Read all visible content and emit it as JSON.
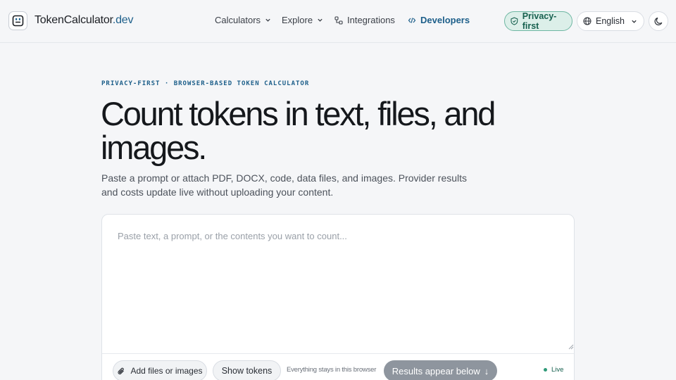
{
  "header": {
    "brand_main": "TokenCalculator",
    "brand_tld": ".dev",
    "nav": {
      "calculators": "Calculators",
      "explore": "Explore",
      "integrations": "Integrations",
      "developers": "Developers"
    },
    "privacy_badge": "Privacy-first",
    "language": "English",
    "icons": [
      "logo-icon",
      "chevron-down-icon",
      "integrations-icon",
      "code-icon",
      "shield-check-icon",
      "globe-icon",
      "moon-icon"
    ]
  },
  "hero": {
    "eyebrow": "PRIVACY-FIRST · BROWSER-BASED TOKEN CALCULATOR",
    "headline": "Count tokens in text, files, and images.",
    "subtext": "Paste a prompt or attach PDF, DOCX, code, data files, and images. Provider results and costs update live without uploading your content."
  },
  "input": {
    "placeholder": "Paste text, a prompt, or the contents you want to count...",
    "value": ""
  },
  "actions": {
    "add_files": "Add files or images",
    "show_tokens": "Show tokens",
    "stays_note": "Everything stays in this browser",
    "results": "Results appear below",
    "results_arrow": "↓",
    "live": "Live"
  },
  "colors": {
    "accent": "#1d5f8a",
    "privacy_bg": "#dcefe9",
    "privacy_text": "#17614f",
    "results_button": "#8e959e",
    "live_dot": "#2f9a78"
  }
}
